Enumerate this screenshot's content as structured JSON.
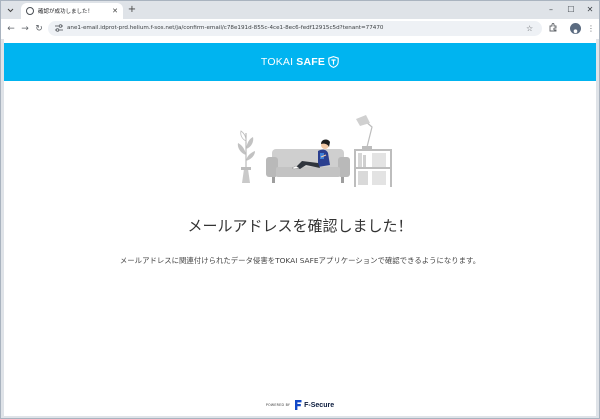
{
  "browser": {
    "tab_title": "確認が成功しました！",
    "url": "ane1-email.idprot-prd.helium.f-sos.net/ja/confirm-email/c78e191d-855c-4ce1-8ec6-fedf12915c5d?tenant=77470",
    "icons": {
      "back": "arrow-left-icon",
      "forward": "arrow-right-icon",
      "reload": "reload-icon",
      "bookmark": "star-icon",
      "extensions": "puzzle-icon",
      "profile": "profile-icon",
      "menu": "kebab-menu-icon"
    }
  },
  "page": {
    "brand": {
      "prefix": "TOKAI",
      "name": "SAFE",
      "color": "#00b4f0"
    },
    "headline": "メールアドレスを確認しました！",
    "description": "メールアドレスに関連付けられたデータ侵害をTOKAI SAFEアプリケーションで確認できるようになります。",
    "footer": {
      "powered_by": "POWERED BY",
      "company": "F-Secure"
    }
  }
}
